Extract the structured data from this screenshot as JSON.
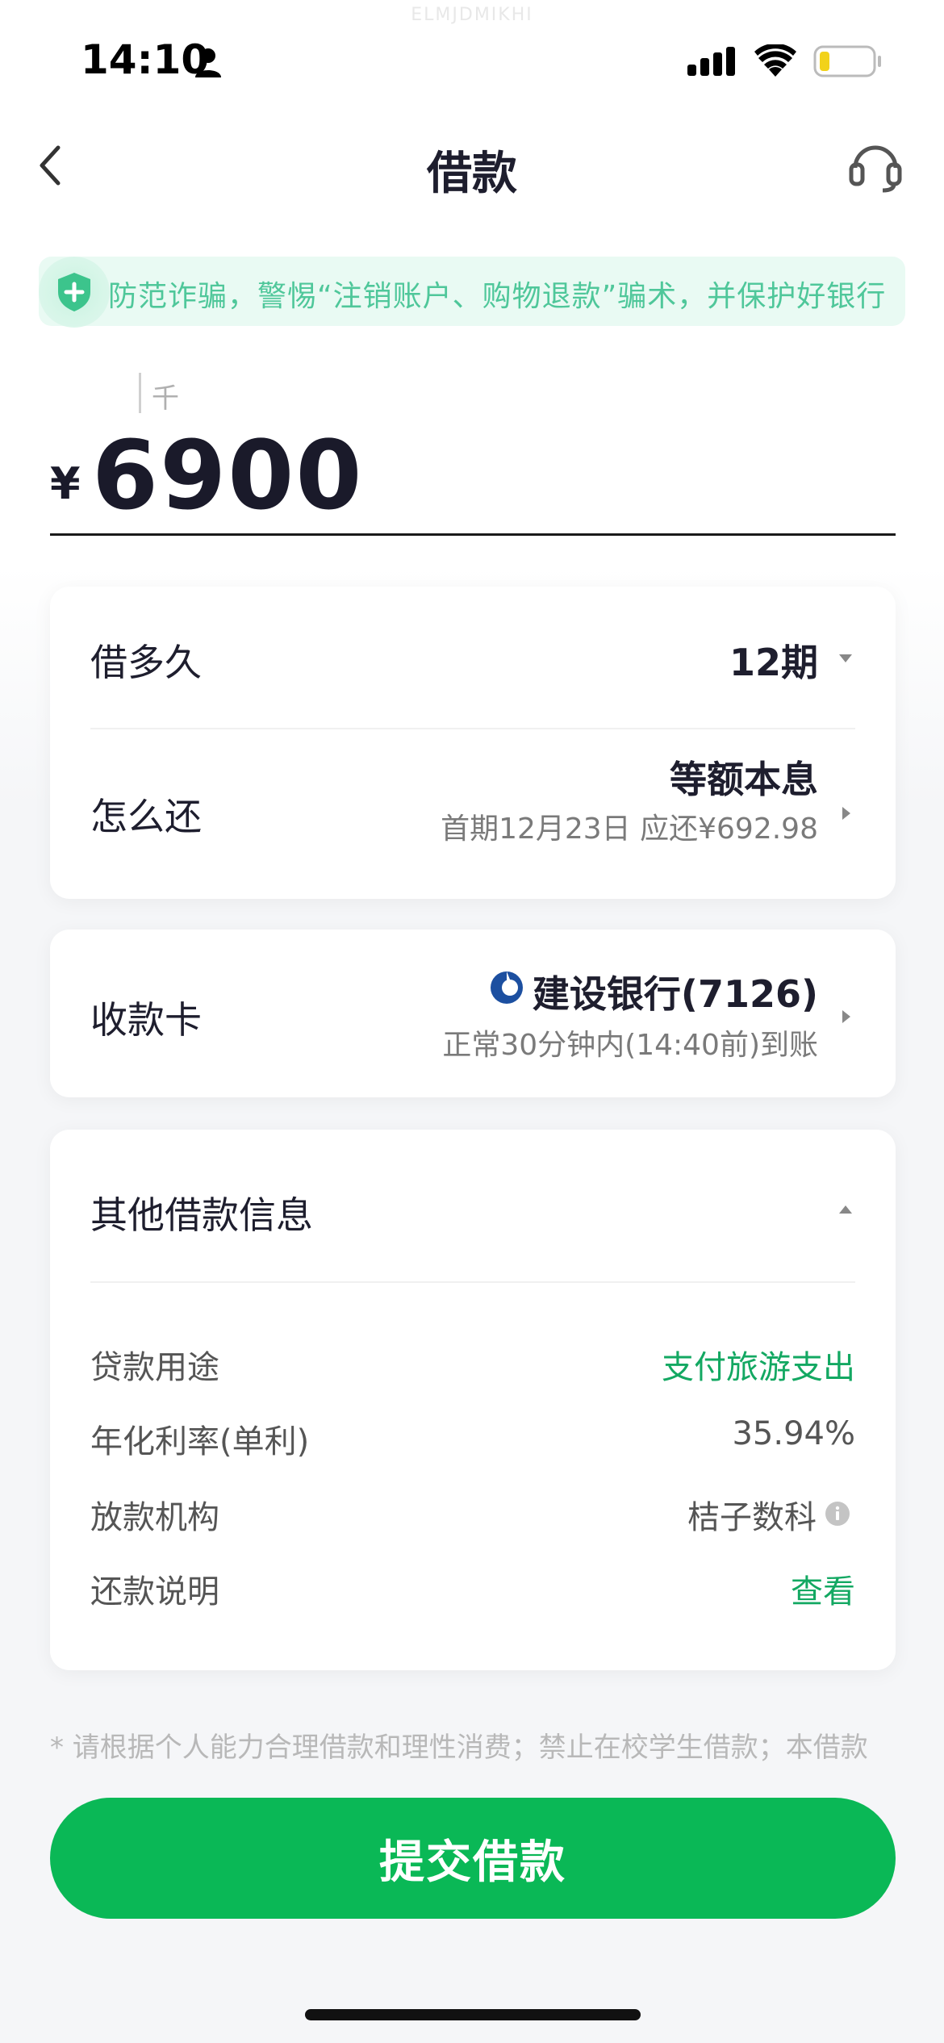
{
  "watermark": "ELMJDMIKHI",
  "status_bar": {
    "time": "14:10"
  },
  "nav": {
    "title": "借款"
  },
  "notice": {
    "text": "防范诈骗，警惕“注销账户、购物退款”骗术，并保护好银行"
  },
  "amount": {
    "unit_hint": "千",
    "currency": "¥",
    "value": "6900"
  },
  "loan": {
    "term_label": "借多久",
    "term_value": "12期",
    "repay_label": "怎么还",
    "repay_method": "等额本息",
    "repay_detail": "首期12月23日 应还¥692.98"
  },
  "card": {
    "label": "收款卡",
    "bank": "建设银行(7126)",
    "arrival": "正常30分钟内(14:40前)到账"
  },
  "other": {
    "title": "其他借款信息",
    "items": [
      {
        "label": "贷款用途",
        "value": "支付旅游支出"
      },
      {
        "label": "年化利率(单利)",
        "value": "35.94%"
      },
      {
        "label": "放款机构",
        "value": "桔子数科"
      },
      {
        "label": "还款说明",
        "value": "查看"
      }
    ]
  },
  "disclaimer": "* 请根据个人能力合理借款和理性消费；禁止在校学生借款；本借款",
  "submit_label": "提交借款",
  "colors": {
    "accent": "#0ab856",
    "link": "#13a862",
    "notice_bg": "#e9faf3",
    "bank_logo": "#1c4fa0"
  }
}
